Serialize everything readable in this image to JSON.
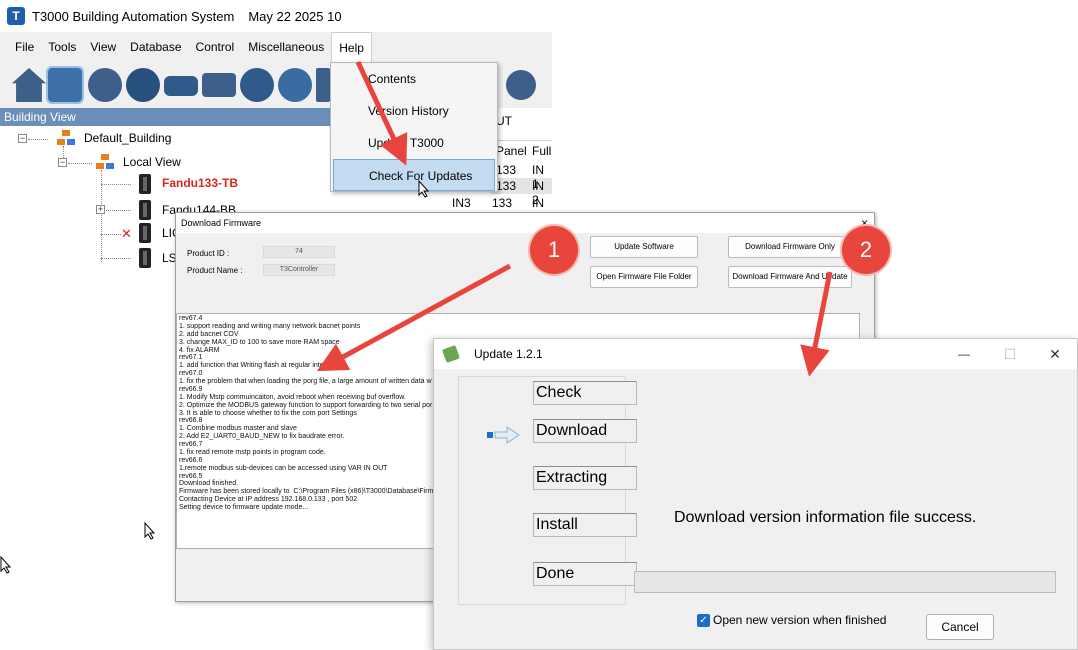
{
  "app": {
    "title": "T3000 Building Automation System",
    "date": "May 22 2025 10",
    "menu": [
      "File",
      "Tools",
      "View",
      "Database",
      "Control",
      "Miscellaneous",
      "Help"
    ],
    "building_view_label": "Building View",
    "tree": {
      "root": "Default_Building",
      "local_view": "Local View",
      "devices": [
        "Fandu133-TB",
        "Fandu144-BB",
        "LIC",
        "LS"
      ]
    },
    "io_table": {
      "header_partial": "UT",
      "columns": [
        "Panel",
        "Full"
      ],
      "rows": [
        {
          "label": "",
          "panel": "133",
          "full": "IN 1"
        },
        {
          "label": "",
          "panel": "133",
          "full": "IN 2"
        },
        {
          "label": "IN3",
          "panel": "133",
          "full": "IN 3"
        }
      ]
    },
    "help_menu": [
      "Contents",
      "Version History",
      "Update T3000",
      "Check For Updates"
    ]
  },
  "firmware": {
    "title": "Download Firmware",
    "close": "×",
    "product_id_label": "Product ID :",
    "product_id": "74",
    "product_name_label": "Product Name :",
    "product_name": "T3Controller",
    "buttons": {
      "update_software": "Update Software",
      "download_only": "Download Firmware Only",
      "open_folder": "Open Firmware File Folder",
      "download_update": "Download Firmware And Update"
    },
    "log": "rev67.4\n1. support reading and writing many network bacnet points\n2. add bacnet COV\n3. change MAX_ID to 100 to save more RAM space\n4. fix ALARM\nrev67.1\n1. add function that Writing flash at regular intervals\nrev67.0\n1. fix the problem that when loading the porg file, a large amount of written data w\nrev66.9\n1. Modify Mstp commuincaiton, avoid reboot when receiving buf overflow.\n2. Optimize the MODBUS gateway function to support forwarding to two serial por\n3. It is able to choose whether to fix the com port Settings\nrev66.8\n1. Combine modbus master and slave\n2. Add E2_UART0_BAUD_NEW to fix baudrate error.\nrev66.7\n1. fix read remote mstp points in program code.\nrev66.6\n1.remote modbus sub-devices can be accessed using VAR IN OUT\nrev66.5\nDownload finished.\nFirmware has been stored locally to  C:\\Program Files (x86)\\T3000\\Database\\Firm\nContacting Device at IP address 192.168.0.133 , port 502\nSetting device to firmware update mode..."
  },
  "update": {
    "title": "Update 1.2.1",
    "minimize": "—",
    "maximize": "☐",
    "close": "✕",
    "steps": [
      "Check",
      "Download",
      "Extracting",
      "Install",
      "Done"
    ],
    "message": "Download version information file success.",
    "progress": 0,
    "checkbox_label": "Open new version when finished",
    "checkbox_checked": true,
    "cancel": "Cancel"
  },
  "annotations": {
    "badge1": "1",
    "badge2": "2",
    "color": "#e8453c"
  }
}
